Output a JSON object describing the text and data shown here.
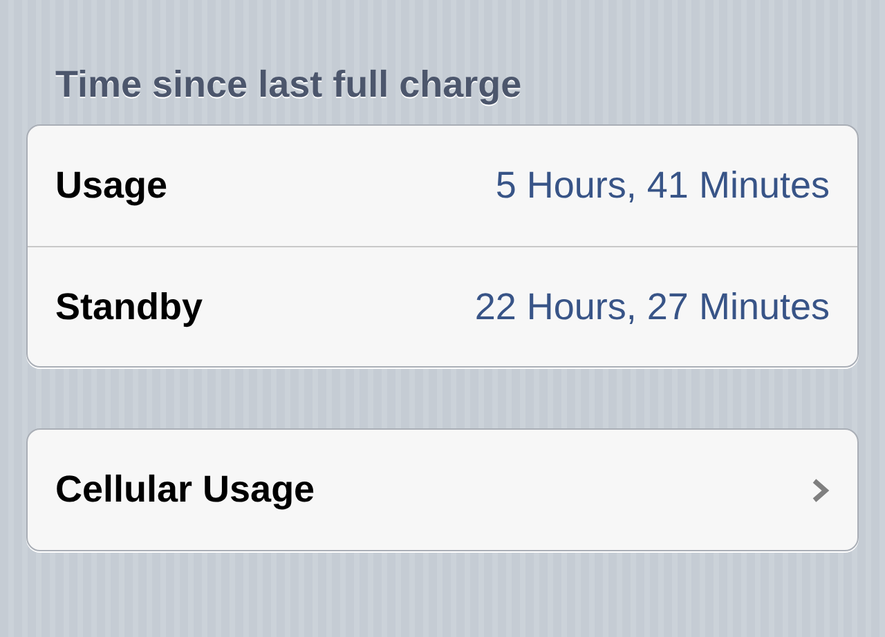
{
  "section_header": "Time since last full charge",
  "usage_group": [
    {
      "label": "Usage",
      "value": "5 Hours, 41 Minutes"
    },
    {
      "label": "Standby",
      "value": "22 Hours, 27 Minutes"
    }
  ],
  "links": [
    {
      "label": "Cellular Usage"
    }
  ]
}
